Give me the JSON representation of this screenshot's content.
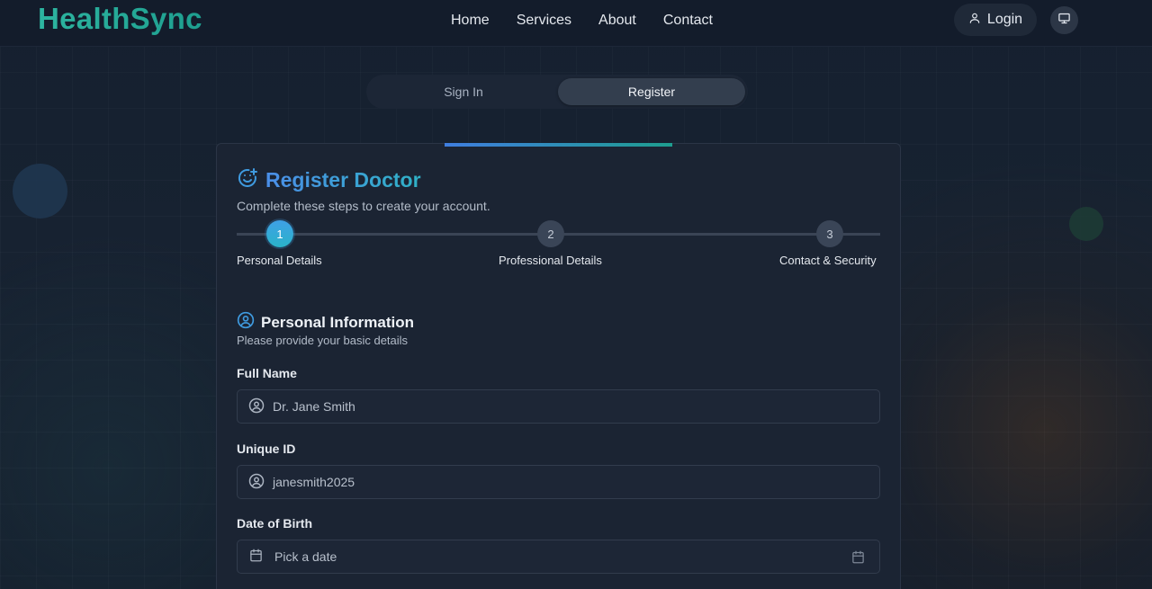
{
  "brand": {
    "name": "HealthSync"
  },
  "nav": {
    "items": [
      "Home",
      "Services",
      "About",
      "Contact"
    ]
  },
  "header": {
    "login_label": "Login",
    "theme_toggle_icon": "monitor-icon"
  },
  "auth_toggle": {
    "signin_label": "Sign In",
    "register_label": "Register",
    "active": "Register"
  },
  "card": {
    "title": "Register Doctor",
    "subtitle": "Complete these steps to create your account.",
    "title_icon": "smile-plus-icon"
  },
  "stepper": {
    "current_step": 1,
    "steps": [
      {
        "number": "1",
        "label": "Personal Details"
      },
      {
        "number": "2",
        "label": "Professional Details"
      },
      {
        "number": "3",
        "label": "Contact & Security"
      }
    ]
  },
  "section": {
    "title": "Personal Information",
    "subtitle": "Please provide your basic details",
    "icon": "user-circle-icon"
  },
  "fields": {
    "full_name": {
      "label": "Full Name",
      "value": "Dr. Jane Smith",
      "icon": "user-circle-icon"
    },
    "unique_id": {
      "label": "Unique ID",
      "value": "janesmith2025",
      "icon": "user-circle-icon"
    },
    "dob": {
      "label": "Date of Birth",
      "placeholder": "Pick a date",
      "icon": "calendar-icon"
    }
  },
  "colors": {
    "brand_teal": "#1e9e8f",
    "accent_blue": "#3f7ee0",
    "step_active": "#2ab3c9",
    "background": "#151f2d",
    "card": "#1b2433"
  }
}
